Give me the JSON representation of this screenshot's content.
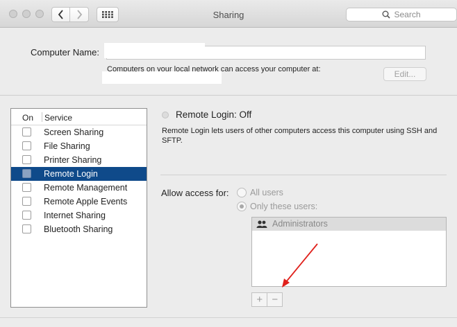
{
  "window": {
    "title": "Sharing",
    "search_placeholder": "Search"
  },
  "top": {
    "computer_name_label": "Computer Name:",
    "network_text": "Computers on your local network can access your computer at:",
    "edit_label": "Edit..."
  },
  "service_list": {
    "header_on": "On",
    "header_service": "Service",
    "items": [
      {
        "label": "Screen Sharing",
        "on": false,
        "selected": false
      },
      {
        "label": "File Sharing",
        "on": false,
        "selected": false
      },
      {
        "label": "Printer Sharing",
        "on": false,
        "selected": false
      },
      {
        "label": "Remote Login",
        "on": false,
        "selected": true
      },
      {
        "label": "Remote Management",
        "on": false,
        "selected": false
      },
      {
        "label": "Remote Apple Events",
        "on": false,
        "selected": false
      },
      {
        "label": "Internet Sharing",
        "on": false,
        "selected": false
      },
      {
        "label": "Bluetooth Sharing",
        "on": false,
        "selected": false
      }
    ]
  },
  "detail": {
    "status_title": "Remote Login: Off",
    "description": "Remote Login lets users of other computers access this computer using SSH and SFTP.",
    "allow_access_label": "Allow access for:",
    "radio_all": "All users",
    "radio_only": "Only these users:",
    "selected_option": "Only these users:",
    "users": [
      "Administrators"
    ],
    "add_label": "+",
    "remove_label": "−"
  },
  "colors": {
    "selection": "#0f4a8a",
    "annotation_arrow": "#e0201b"
  }
}
